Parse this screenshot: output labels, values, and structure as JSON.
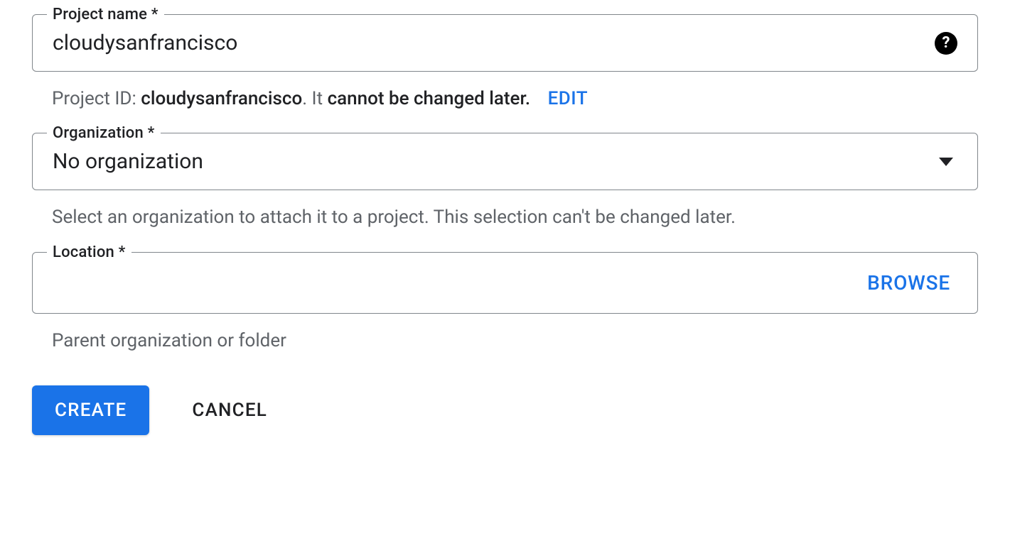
{
  "projectName": {
    "label": "Project name *",
    "value": "cloudysanfrancisco",
    "helperPrefix": "Project ID: ",
    "projectId": "cloudysanfrancisco",
    "helperMiddle": ". It ",
    "helperBold": "cannot be changed later.",
    "editLabel": "EDIT"
  },
  "organization": {
    "label": "Organization *",
    "value": "No organization",
    "helperText": "Select an organization to attach it to a project. This selection can't be changed later."
  },
  "location": {
    "label": "Location *",
    "browseLabel": "BROWSE",
    "helperText": "Parent organization or folder"
  },
  "buttons": {
    "create": "CREATE",
    "cancel": "CANCEL"
  }
}
